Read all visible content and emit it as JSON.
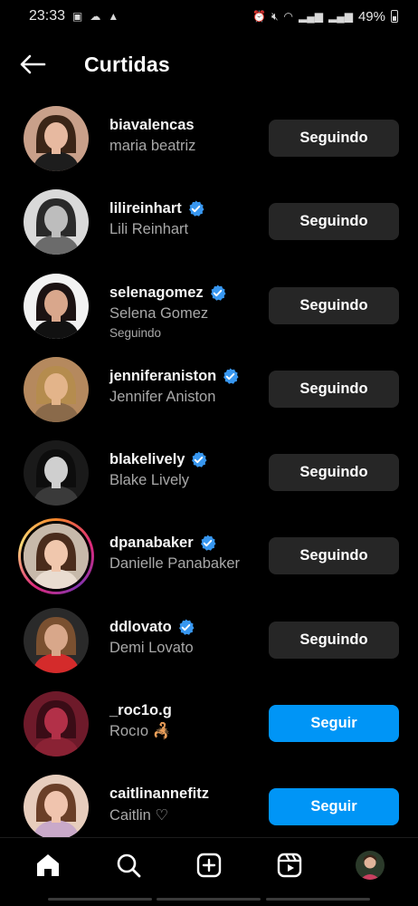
{
  "status_bar": {
    "time": "23:33",
    "battery": "49%",
    "notification_icon_names": [
      "gallery-icon",
      "cloud-icon",
      "carrier-icon"
    ],
    "system_icon_names": [
      "alarm-icon",
      "mute-icon",
      "wifi-icon",
      "signal-icon",
      "signal-icon",
      "battery-icon"
    ]
  },
  "header": {
    "title": "Curtidas"
  },
  "colors": {
    "background": "#000000",
    "button_following": "#262626",
    "button_follow": "#0095f6",
    "verified": "#3897f0",
    "secondary_text": "#a8a8a8"
  },
  "users": [
    {
      "username": "biavalencas",
      "fullname": "maria beatriz",
      "verified": false,
      "subline": "",
      "button": "Seguindo",
      "button_style": "secondary",
      "story": false
    },
    {
      "username": "lilireinhart",
      "fullname": "Lili Reinhart",
      "verified": true,
      "subline": "",
      "button": "Seguindo",
      "button_style": "secondary",
      "story": false
    },
    {
      "username": "selenagomez",
      "fullname": "Selena Gomez",
      "verified": true,
      "subline": "Seguindo",
      "button": "Seguindo",
      "button_style": "secondary",
      "story": false
    },
    {
      "username": "jenniferaniston",
      "fullname": "Jennifer Aniston",
      "verified": true,
      "subline": "",
      "button": "Seguindo",
      "button_style": "secondary",
      "story": false
    },
    {
      "username": "blakelively",
      "fullname": "Blake Lively",
      "verified": true,
      "subline": "",
      "button": "Seguindo",
      "button_style": "secondary",
      "story": false
    },
    {
      "username": "dpanabaker",
      "fullname": "Danielle Panabaker",
      "verified": true,
      "subline": "",
      "button": "Seguindo",
      "button_style": "secondary",
      "story": true
    },
    {
      "username": "ddlovato",
      "fullname": "Demi Lovato",
      "verified": true,
      "subline": "",
      "button": "Seguindo",
      "button_style": "secondary",
      "story": false
    },
    {
      "username": "_roc1o.g",
      "fullname": "Rocıo 🦂",
      "verified": false,
      "subline": "",
      "button": "Seguir",
      "button_style": "primary",
      "story": false
    },
    {
      "username": "caitlinannefitz",
      "fullname": "Caitlin ♡",
      "verified": false,
      "subline": "",
      "button": "Seguir",
      "button_style": "primary",
      "story": false
    }
  ],
  "bottom_nav": {
    "items": [
      "home-icon",
      "search-icon",
      "new-post-icon",
      "reels-icon",
      "profile-avatar"
    ]
  }
}
